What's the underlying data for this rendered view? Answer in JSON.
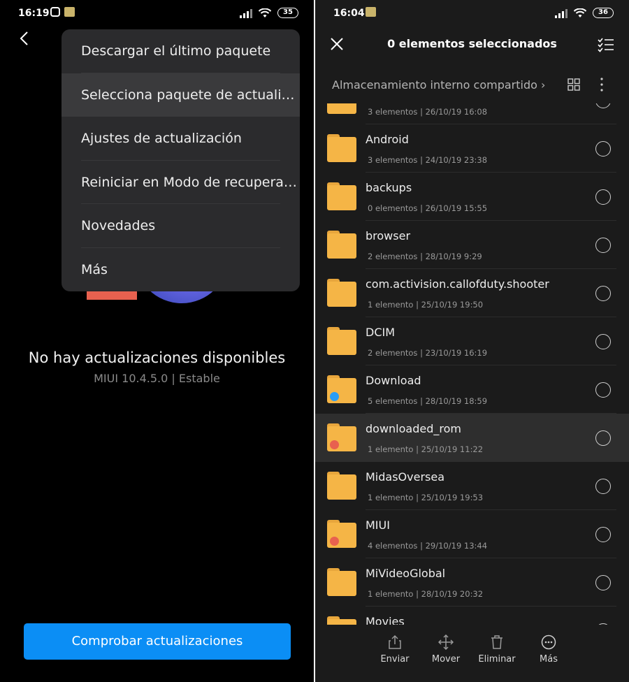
{
  "left": {
    "status_bar": {
      "time": "16:19",
      "battery": "35"
    },
    "menu": {
      "items": [
        {
          "label": "Descargar el último paquete"
        },
        {
          "label": "Selecciona paquete de actuali…"
        },
        {
          "label": "Ajustes de actualización"
        },
        {
          "label": "Reiniciar en Modo de recupera…"
        },
        {
          "label": "Novedades"
        },
        {
          "label": "Más"
        }
      ]
    },
    "status_title": "No hay actualizaciones disponibles",
    "version": "MIUI 10.4.5.0 | Estable",
    "check_button": "Comprobar actualizaciones",
    "colors": {
      "accent": "#0b8ef5",
      "menu_bg": "#2b2b2d"
    }
  },
  "right": {
    "status_bar": {
      "time": "16:04",
      "battery": "36"
    },
    "title": "0 elementos seleccionados",
    "path": "Almacenamiento interno compartido",
    "files": [
      {
        "name": "",
        "count": "3 elementos",
        "date": "26/10/19 16:08"
      },
      {
        "name": "Android",
        "count": "3 elementos",
        "date": "24/10/19 23:38"
      },
      {
        "name": "backups",
        "count": "0 elementos",
        "date": "26/10/19 15:55"
      },
      {
        "name": "browser",
        "count": "2 elementos",
        "date": "28/10/19 9:29"
      },
      {
        "name": "com.activision.callofduty.shooter",
        "count": "1 elemento",
        "date": "25/10/19 19:50"
      },
      {
        "name": "DCIM",
        "count": "2 elementos",
        "date": "23/10/19 16:19"
      },
      {
        "name": "Download",
        "count": "5 elementos",
        "date": "28/10/19 18:59"
      },
      {
        "name": "downloaded_rom",
        "count": "1 elemento",
        "date": "25/10/19 11:22"
      },
      {
        "name": "MidasOversea",
        "count": "1 elemento",
        "date": "25/10/19 19:53"
      },
      {
        "name": "MIUI",
        "count": "4 elementos",
        "date": "29/10/19 13:44"
      },
      {
        "name": "MiVideoGlobal",
        "count": "1 elemento",
        "date": "28/10/19 20:32"
      },
      {
        "name": "Movies",
        "count": "",
        "date": ""
      }
    ],
    "bottom_actions": [
      {
        "label": "Enviar",
        "icon": "share-icon"
      },
      {
        "label": "Mover",
        "icon": "move-icon"
      },
      {
        "label": "Eliminar",
        "icon": "trash-icon"
      },
      {
        "label": "Más",
        "icon": "more-icon"
      }
    ],
    "colors": {
      "folder": "#f5b546",
      "download_badge": "#2a9df4",
      "rom_badge": "#e8614f"
    }
  }
}
